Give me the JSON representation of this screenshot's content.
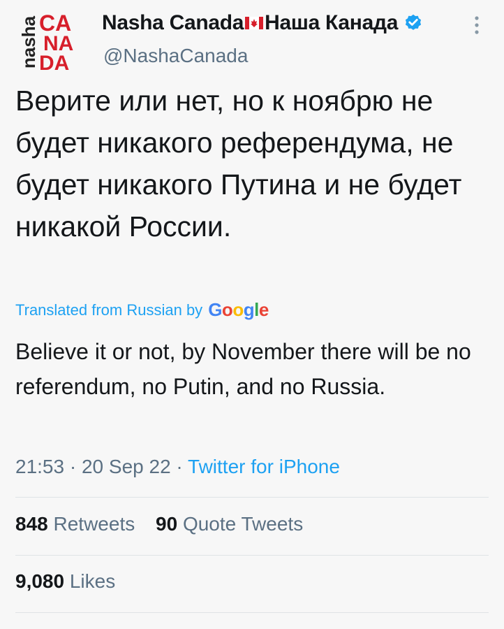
{
  "header": {
    "display_name_en": "Nasha Canada",
    "display_name_ru": "Наша Канада",
    "handle": "@NashaCanada",
    "avatar_text": {
      "vertical": "nasha",
      "line1": "CA",
      "line2": "NA",
      "line3": "DA"
    },
    "icons": {
      "flag": "canada-flag-icon",
      "verified": "verified-badge-icon",
      "more": "more-options-icon"
    }
  },
  "tweet": {
    "text": "Верите или нет, но к ноябрю не будет никакого референдума, не будет никакого Путина и не будет никакой России.",
    "translated_label": "Translated from Russian by",
    "translator": "Google",
    "translation": "Believe it or not, by November there will be no referendum, no Putin, and no Russia."
  },
  "meta": {
    "time": "21:53",
    "separator": "·",
    "date": "20 Sep 22",
    "source": "Twitter for iPhone"
  },
  "stats": {
    "retweets_count": "848",
    "retweets_label": "Retweets",
    "quotes_count": "90",
    "quotes_label": "Quote Tweets",
    "likes_count": "9,080",
    "likes_label": "Likes"
  },
  "colors": {
    "accent": "#1da1f2",
    "muted": "#5b7083",
    "text": "#14171a",
    "avatar_red": "#d71f2b"
  }
}
